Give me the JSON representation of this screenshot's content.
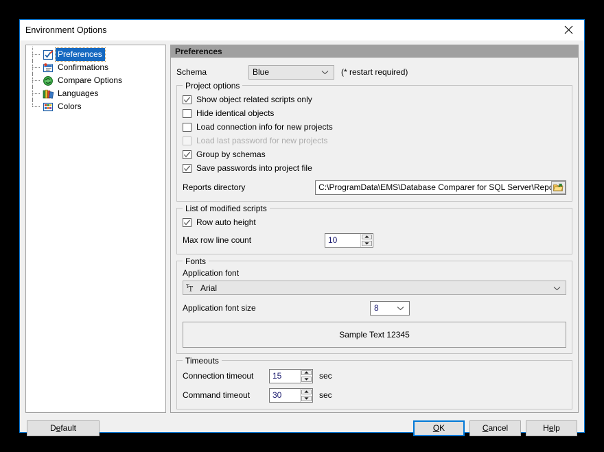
{
  "window": {
    "title": "Environment Options",
    "close_icon": "close-icon"
  },
  "sidebar": {
    "items": [
      {
        "label": "Preferences",
        "icon": "preferences-icon",
        "selected": true
      },
      {
        "label": "Confirmations",
        "icon": "confirmations-icon",
        "selected": false
      },
      {
        "label": "Compare Options",
        "icon": "compare-options-icon",
        "selected": false
      },
      {
        "label": "Languages",
        "icon": "languages-icon",
        "selected": false
      },
      {
        "label": "Colors",
        "icon": "colors-icon",
        "selected": false
      }
    ]
  },
  "panel": {
    "header": "Preferences",
    "schema": {
      "label": "Schema",
      "value": "Blue",
      "note": "(* restart required)",
      "chevron_icon": "chevron-down-icon"
    },
    "project_options": {
      "legend": "Project options",
      "checkboxes": [
        {
          "label": "Show object related scripts only",
          "checked": true,
          "disabled": false
        },
        {
          "label": "Hide identical objects",
          "checked": false,
          "disabled": false
        },
        {
          "label": "Load connection info for new projects",
          "checked": false,
          "disabled": false
        },
        {
          "label": "Load last password for new projects",
          "checked": false,
          "disabled": true
        },
        {
          "label": "Group by schemas",
          "checked": true,
          "disabled": false
        },
        {
          "label": "Save passwords into project file",
          "checked": true,
          "disabled": false
        }
      ],
      "reports_directory": {
        "label": "Reports directory",
        "value": "C:\\ProgramData\\EMS\\Database Comparer for SQL Server\\Reports\\",
        "browse_icon": "open-folder-icon"
      }
    },
    "modified_scripts": {
      "legend": "List of modified scripts",
      "row_auto_height": {
        "label": "Row auto height",
        "checked": true
      },
      "max_row_line_count": {
        "label": "Max row line count",
        "value": "10"
      }
    },
    "fonts": {
      "legend": "Fonts",
      "application_font": {
        "label": "Application font",
        "value": "Arial",
        "font_icon": "truetype-font-icon",
        "chevron_icon": "chevron-down-icon"
      },
      "application_font_size": {
        "label": "Application font size",
        "value": "8",
        "chevron_icon": "chevron-down-icon"
      },
      "sample_text": "Sample Text 12345"
    },
    "timeouts": {
      "legend": "Timeouts",
      "connection": {
        "label": "Connection timeout",
        "value": "15",
        "unit": "sec"
      },
      "command": {
        "label": "Command timeout",
        "value": "30",
        "unit": "sec"
      }
    }
  },
  "buttons": {
    "default": {
      "pre": "D",
      "accel": "e",
      "post": "fault"
    },
    "ok": {
      "pre": "",
      "accel": "O",
      "post": "K"
    },
    "cancel": {
      "pre": "",
      "accel": "C",
      "post": "ancel"
    },
    "help": {
      "pre": "H",
      "accel": "e",
      "post": "lp"
    }
  },
  "colors": {
    "accent": "#0078d7",
    "selection": "#1669c1",
    "header_bar": "#a0a0a0",
    "dialog_bg": "#f0f0f0"
  }
}
